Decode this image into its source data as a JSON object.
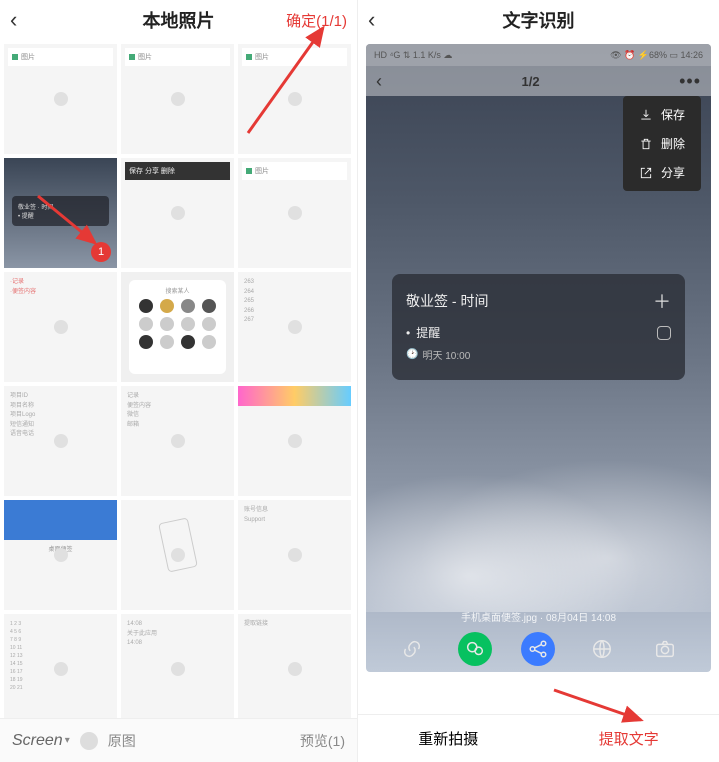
{
  "left": {
    "title": "本地照片",
    "confirm": "确定(1/1)",
    "selected_badge": "1",
    "bottom": {
      "screen": "Screen",
      "origin": "原图",
      "preview": "预览(1)"
    },
    "mini": {
      "row1": "·记录",
      "row2": "·便签内容",
      "label_top": "图片"
    },
    "apps_title": "搜索某人"
  },
  "right": {
    "title": "文字识别",
    "status": {
      "left": "HD ⁴G ⇅ 1.1 K/s ☁",
      "right": "👁 ⏰ ⚡68% ▭ 14:26"
    },
    "page": "1/2",
    "menu": {
      "save": "保存",
      "delete": "删除",
      "share": "分享"
    },
    "card": {
      "title": "敬业签 - 时间",
      "item": "提醒",
      "sub": "明天 10:00",
      "clock": "🕑"
    },
    "filename": "手机桌面便签.jpg · 08月04日 14:08",
    "bottom": {
      "retake": "重新拍摄",
      "extract": "提取文字"
    }
  }
}
